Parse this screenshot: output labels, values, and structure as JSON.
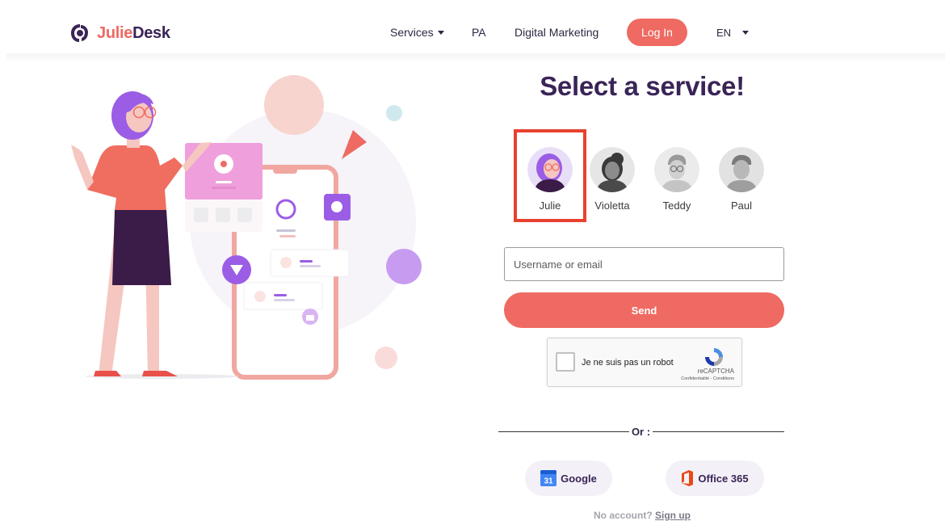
{
  "brand": {
    "name_part1": "Julie",
    "name_part2": "Desk"
  },
  "nav": {
    "services": "Services",
    "pa": "PA",
    "digital_marketing": "Digital Marketing",
    "login": "Log In",
    "language": "EN"
  },
  "main": {
    "title": "Select a service!",
    "assistants": [
      {
        "name": "Julie",
        "selected": true
      },
      {
        "name": "Violetta",
        "selected": false
      },
      {
        "name": "Teddy",
        "selected": false
      },
      {
        "name": "Paul",
        "selected": false
      }
    ],
    "username_placeholder": "Username or email",
    "send_label": "Send",
    "captcha": {
      "label": "Je ne suis pas un robot",
      "brand": "reCAPTCHA",
      "terms": "Confidentialité - Conditions"
    },
    "or_label": "Or :",
    "sso": {
      "google": "Google",
      "google_icon_text": "31",
      "office": "Office 365"
    },
    "signup": {
      "prompt": "No account?",
      "link": "Sign up"
    }
  },
  "colors": {
    "accent": "#ee6a62",
    "brand_dark": "#3a2457",
    "selection_border": "#e8412f",
    "purple": "#9b5de5"
  }
}
